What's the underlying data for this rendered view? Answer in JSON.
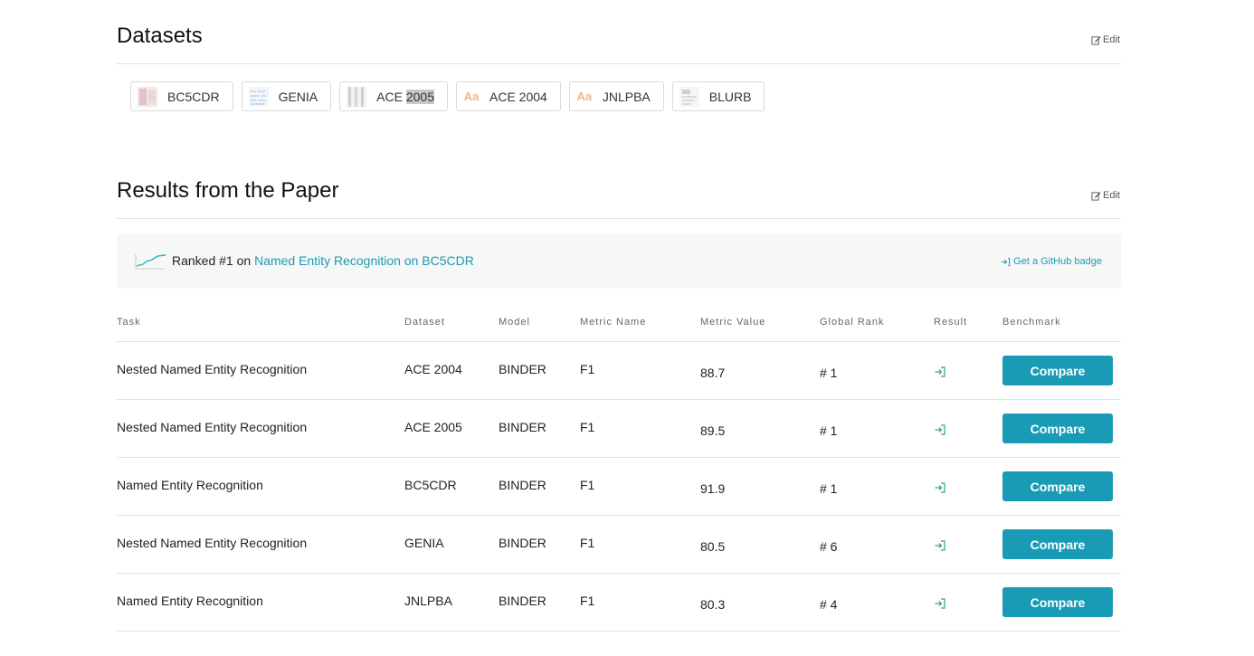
{
  "datasets": {
    "title": "Datasets",
    "edit_label": "Edit",
    "chips": [
      {
        "label": "BC5CDR",
        "icon": "dataset-thumbnail",
        "highlight": ""
      },
      {
        "label": "GENIA",
        "icon": "dataset-thumbnail",
        "highlight": ""
      },
      {
        "label": "ACE ",
        "icon": "dataset-thumbnail",
        "highlight": "2005"
      },
      {
        "label": "ACE 2004",
        "icon": "aa-text-icon",
        "highlight": ""
      },
      {
        "label": "JNLPBA",
        "icon": "aa-text-icon",
        "highlight": ""
      },
      {
        "label": "BLURB",
        "icon": "dataset-thumbnail",
        "highlight": ""
      }
    ],
    "aa_glyph": "Aa"
  },
  "results": {
    "title": "Results from the Paper",
    "edit_label": "Edit",
    "banner": {
      "prefix": "Ranked #1 on ",
      "link": "Named Entity Recognition on BC5CDR",
      "badge_label": "Get a GitHub badge"
    },
    "columns": [
      "Task",
      "Dataset",
      "Model",
      "Metric Name",
      "Metric Value",
      "Global Rank",
      "Result",
      "Benchmark"
    ],
    "rows": [
      {
        "task": "Nested Named Entity Recognition",
        "dataset": "ACE 2004",
        "model": "BINDER",
        "metric_name": "F1",
        "metric_value": "88.7",
        "rank": "# 1",
        "action": "Compare"
      },
      {
        "task": "Nested Named Entity Recognition",
        "dataset": "ACE 2005",
        "model": "BINDER",
        "metric_name": "F1",
        "metric_value": "89.5",
        "rank": "# 1",
        "action": "Compare"
      },
      {
        "task": "Named Entity Recognition",
        "dataset": "BC5CDR",
        "model": "BINDER",
        "metric_name": "F1",
        "metric_value": "91.9",
        "rank": "# 1",
        "action": "Compare"
      },
      {
        "task": "Nested Named Entity Recognition",
        "dataset": "GENIA",
        "model": "BINDER",
        "metric_name": "F1",
        "metric_value": "80.5",
        "rank": "# 6",
        "action": "Compare"
      },
      {
        "task": "Named Entity Recognition",
        "dataset": "JNLPBA",
        "model": "BINDER",
        "metric_name": "F1",
        "metric_value": "80.3",
        "rank": "# 4",
        "action": "Compare"
      }
    ]
  },
  "colors": {
    "accent": "#1a9bb5",
    "border": "#e2e2e2",
    "banner_bg": "#f7f7f7"
  }
}
